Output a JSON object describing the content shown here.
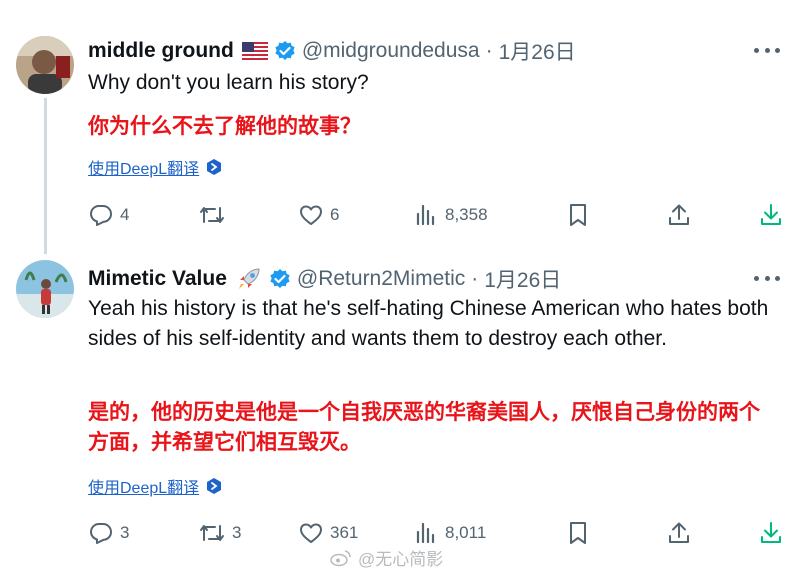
{
  "tweets": [
    {
      "display_name": "middle ground",
      "name_emoji": "us-flag",
      "verified_icon": "verified-badge-icon",
      "handle": "@midgroundedusa",
      "separator": "·",
      "date": "1月26日",
      "text": "Why don't you learn his story?",
      "translation": "你为什么不去了解他的故事？",
      "translate_link": "使用DeepL翻译",
      "stats": {
        "replies": "4",
        "retweets": "",
        "likes": "6",
        "views": "8,358"
      }
    },
    {
      "display_name": "Mimetic Value",
      "name_emoji": "rocket",
      "verified_icon": "verified-badge-icon",
      "handle": "@Return2Mimetic",
      "separator": "·",
      "date": "1月26日",
      "text": "Yeah his history is that he's self-hating Chinese American who hates both sides of his self-identity and wants them to destroy each other.",
      "translation": "是的，他的历史是他是一个自我厌恶的华裔美国人，厌恨自己身份的两个方面，并希望它们相互毁灭。",
      "translate_link": "使用DeepL翻译",
      "stats": {
        "replies": "3",
        "retweets": "3",
        "likes": "361",
        "views": "8,011"
      }
    }
  ],
  "watermark": {
    "text": "@无心简影"
  },
  "colors": {
    "verified": "#1d9bf0",
    "translation_red": "#e8141a",
    "link_blue": "#1d63c9",
    "muted": "#536471",
    "download_green": "#00ba7c"
  }
}
